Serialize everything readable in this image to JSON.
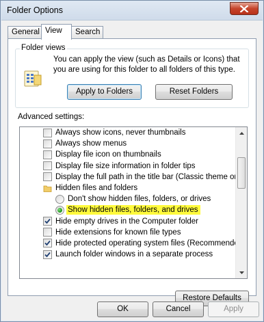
{
  "window": {
    "title": "Folder Options"
  },
  "tabs": [
    "General",
    "View",
    "Search"
  ],
  "active_tab": "View",
  "folder_views": {
    "title": "Folder views",
    "description": "You can apply the view (such as Details or Icons) that you are using for this folder to all folders of this type.",
    "apply_label": "Apply to Folders",
    "reset_label": "Reset Folders"
  },
  "advanced": {
    "label": "Advanced settings:",
    "items": [
      {
        "type": "checkbox",
        "label": "Always show icons, never thumbnails",
        "checked": false
      },
      {
        "type": "checkbox",
        "label": "Always show menus",
        "checked": false
      },
      {
        "type": "checkbox",
        "label": "Display file icon on thumbnails",
        "checked": false
      },
      {
        "type": "checkbox",
        "label": "Display file size information in folder tips",
        "checked": false
      },
      {
        "type": "checkbox",
        "label": "Display the full path in the title bar (Classic theme only)",
        "checked": false
      },
      {
        "type": "folder",
        "label": "Hidden files and folders"
      },
      {
        "type": "radio",
        "label": "Don't show hidden files, folders, or drives",
        "checked": false
      },
      {
        "type": "radio",
        "label": "Show hidden files, folders, and drives",
        "checked": true,
        "highlighted": true
      },
      {
        "type": "checkbox",
        "label": "Hide empty drives in the Computer folder",
        "checked": true
      },
      {
        "type": "checkbox",
        "label": "Hide extensions for known file types",
        "checked": false
      },
      {
        "type": "checkbox",
        "label": "Hide protected operating system files (Recommended)",
        "checked": true
      },
      {
        "type": "checkbox",
        "label": "Launch folder windows in a separate process",
        "checked": true
      }
    ]
  },
  "restore_label": "Restore Defaults",
  "footer": {
    "ok_label": "OK",
    "cancel_label": "Cancel",
    "apply_label": "Apply"
  },
  "colors": {
    "highlight": "#fffa3c",
    "titlebar": "#dfe8f3",
    "close": "#c6452b"
  },
  "icons": {
    "close": "close-icon",
    "folder_views": "folder-views-icon",
    "folder": "folder-icon"
  }
}
